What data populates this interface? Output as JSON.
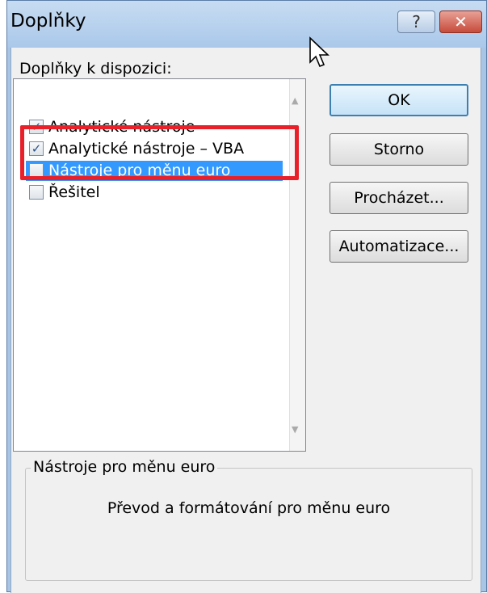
{
  "window": {
    "title": "Doplňky",
    "help_label": "?",
    "close_label": "✕"
  },
  "list": {
    "label": "Doplňky k dispozici:",
    "items": [
      {
        "label": "Analytické nástroje",
        "checked": true
      },
      {
        "label": "Analytické nástroje – VBA",
        "checked": true
      },
      {
        "label": "Nástroje pro měnu euro",
        "checked": false
      },
      {
        "label": "Řešitel",
        "checked": false
      }
    ],
    "selected_index": 2
  },
  "buttons": {
    "ok": "OK",
    "cancel": "Storno",
    "browse": "Procházet...",
    "automation": "Automatizace..."
  },
  "description": {
    "title": "Nástroje pro měnu euro",
    "text": "Převod a formátování pro měnu euro"
  },
  "colors": {
    "selection": "#3399ff",
    "highlight": "#e8202a",
    "titlebar": "#c7dcf2"
  }
}
